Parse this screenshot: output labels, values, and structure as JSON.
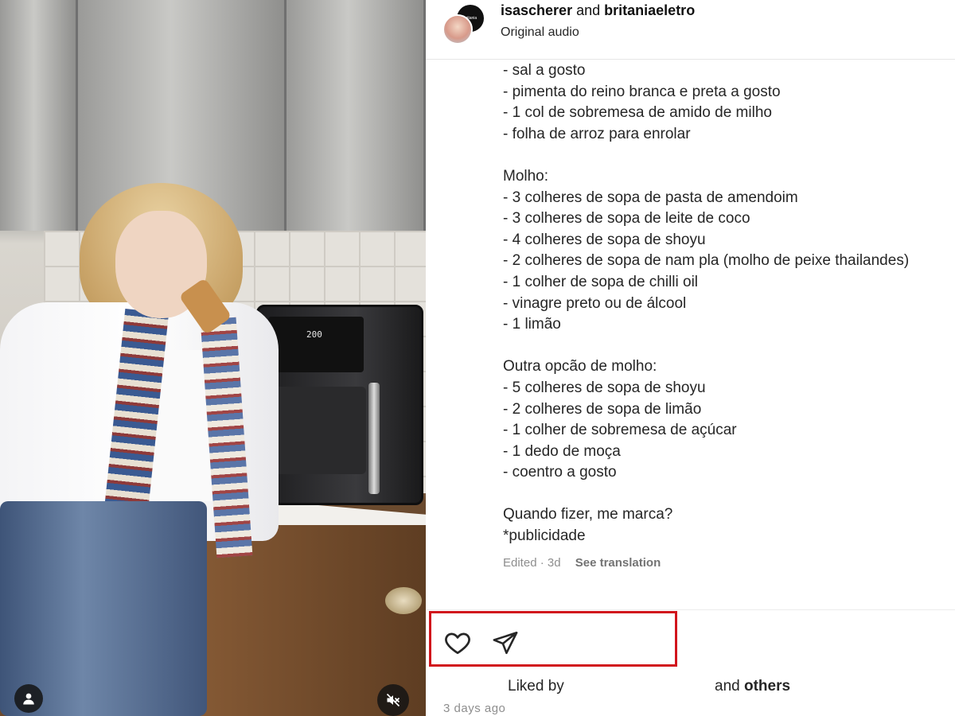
{
  "post": {
    "users": [
      "isascherer",
      "britaniaeletro"
    ],
    "and_word": "and",
    "audio_label": "Original audio",
    "avatar_b_text": "britania"
  },
  "caption_lines": [
    "- sal a gosto",
    "- pimenta do reino branca e preta a gosto",
    "- 1 col de sobremesa de amido de milho",
    "- folha de arroz para enrolar",
    "",
    "Molho:",
    "- 3 colheres de sopa de pasta de amendoim",
    "- 3 colheres de sopa de leite de coco",
    "- 4 colheres de sopa de shoyu",
    "- 2 colheres de sopa de nam pla (molho de peixe thailandes)",
    "- 1 colher de sopa de chilli oil",
    "- vinagre preto ou de álcool",
    "- 1 limão",
    "",
    "Outra opcão de molho:",
    "- 5 colheres de sopa de shoyu",
    "- 2 colheres de sopa de limão",
    "- 1 colher de sobremesa de açúcar",
    "- 1 dedo de moça",
    "- coentro a gosto",
    "",
    "Quando fizer, me marca?",
    "*publicidade"
  ],
  "meta": {
    "edited": "Edited · 3d",
    "see_translation": "See translation"
  },
  "actions": {
    "like_icon": "heart-outline-icon",
    "share_icon": "paper-plane-icon"
  },
  "likes": {
    "liked_by": "Liked by",
    "and": "and",
    "others": "others"
  },
  "timestamp": "3 days ago",
  "media": {
    "oven_display": "200",
    "user_icon": "person-icon",
    "mute_icon": "speaker-muted-icon"
  },
  "colors": {
    "highlight": "#d1141c",
    "text": "#262626",
    "muted": "#8e8e8e"
  }
}
